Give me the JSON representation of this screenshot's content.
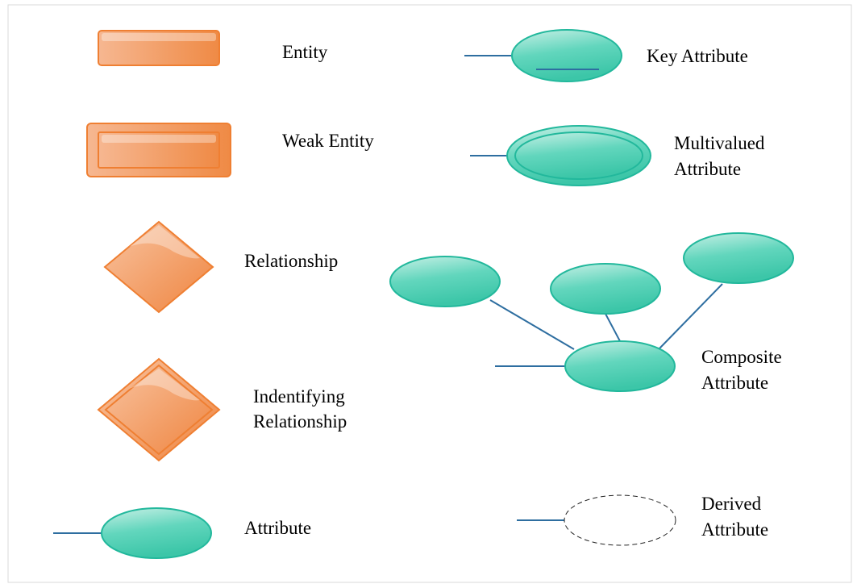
{
  "legend": {
    "entity": {
      "label": "Entity"
    },
    "weak_entity": {
      "label": "Weak Entity"
    },
    "relationship": {
      "label": "Relationship"
    },
    "identifying_relationship": {
      "lines": [
        "Indentifying",
        "Relationship"
      ]
    },
    "attribute": {
      "label": "Attribute"
    },
    "key_attribute": {
      "label": "Key Attribute"
    },
    "multivalued_attribute": {
      "lines": [
        "Multivalued",
        "Attribute"
      ]
    },
    "composite_attribute": {
      "lines": [
        "Composite",
        "Attribute"
      ]
    },
    "derived_attribute": {
      "lines": [
        "Derived",
        "Attribute"
      ]
    }
  },
  "colors": {
    "entity_fill": "#f0914f",
    "entity_stroke": "#ef7f32",
    "attribute_fill": "#4ccfb3",
    "attribute_stroke": "#22b89c",
    "connector": "#2e6ea0"
  }
}
